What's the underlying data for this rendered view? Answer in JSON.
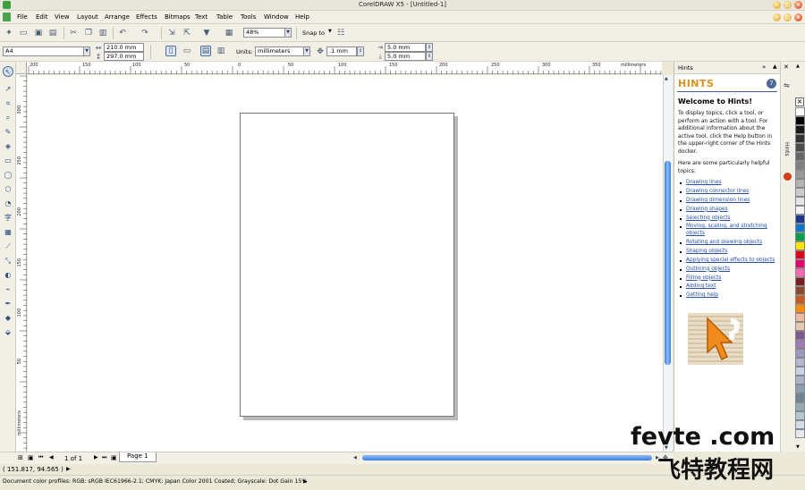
{
  "window": {
    "title": "CorelDRAW X5 - [Untitled-1]"
  },
  "menu": [
    "File",
    "Edit",
    "View",
    "Layout",
    "Arrange",
    "Effects",
    "Bitmaps",
    "Text",
    "Table",
    "Tools",
    "Window",
    "Help"
  ],
  "standard_toolbar": {
    "zoom": "48%",
    "snap_label": "Snap to"
  },
  "property_bar": {
    "page_size": "A4",
    "width": "210.0 mm",
    "height": "297.0 mm",
    "units_label": "Units:",
    "units_value": "millimeters",
    "nudge": ".1 mm",
    "dup_x": "5.0 mm",
    "dup_y": "5.0 mm"
  },
  "rulers": {
    "h_labels": [
      "200",
      "150",
      "100",
      "50",
      "0",
      "50",
      "100",
      "150",
      "200",
      "250",
      "300",
      "350"
    ],
    "h_unit": "millimeters",
    "v_labels": [
      "300",
      "250",
      "200",
      "150",
      "100",
      "50"
    ],
    "v_unit": "millimeters"
  },
  "page_nav": {
    "counter": "1 of 1",
    "tab": "Page 1"
  },
  "status": {
    "coords": "( 151.817, 94.565 )",
    "profiles": "Document color profiles: RGB: sRGB IEC61966-2.1; CMYK: Japan Color 2001 Coated; Grayscale: Dot Gain 15%"
  },
  "hints": {
    "docker_title": "Hints",
    "heading": "HINTS",
    "welcome": "Welcome to Hints!",
    "intro": "To display topics, click a tool, or perform an action with a tool. For additional information about the active tool, click the Help button in the upper-right corner of the Hints docker.",
    "helpful": "Here are some particularly helpful topics:",
    "topics": [
      "Drawing lines",
      "Drawing connector lines",
      "Drawing dimension lines",
      "Drawing shapes",
      "Selecting objects",
      "Moving, scaling, and stretching objects",
      "Rotating and skewing objects",
      "Shaping objects",
      "Applying special effects to objects",
      "Outlining objects",
      "Filling objects",
      "Adding text",
      "Getting help"
    ],
    "tab_label": "Hints"
  },
  "palette": [
    "#ffffff",
    "#000000",
    "#1a1a1a",
    "#333333",
    "#4d4d4d",
    "#666666",
    "#808080",
    "#999999",
    "#b3b3b3",
    "#cccccc",
    "#e6e6e6",
    "#f2f2f2",
    "#1b3a8c",
    "#0a78c8",
    "#00a04a",
    "#ffe600",
    "#e0001b",
    "#e6006e",
    "#ff69b4",
    "#7a1f1f",
    "#8c4a2f",
    "#c85a1e",
    "#ff8c00",
    "#f3b9a0",
    "#e8c8b0",
    "#7d5a8c",
    "#a07ab9",
    "#9a9abe",
    "#b4b4d2",
    "#c8d2e6",
    "#aab4c8",
    "#8ca0b4",
    "#6e8296",
    "#96aab4",
    "#b4c8d2",
    "#d2dce6",
    "#e6ebf0"
  ],
  "watermark": {
    "brand": "fevte .com",
    "cn": "飞特教程网"
  }
}
